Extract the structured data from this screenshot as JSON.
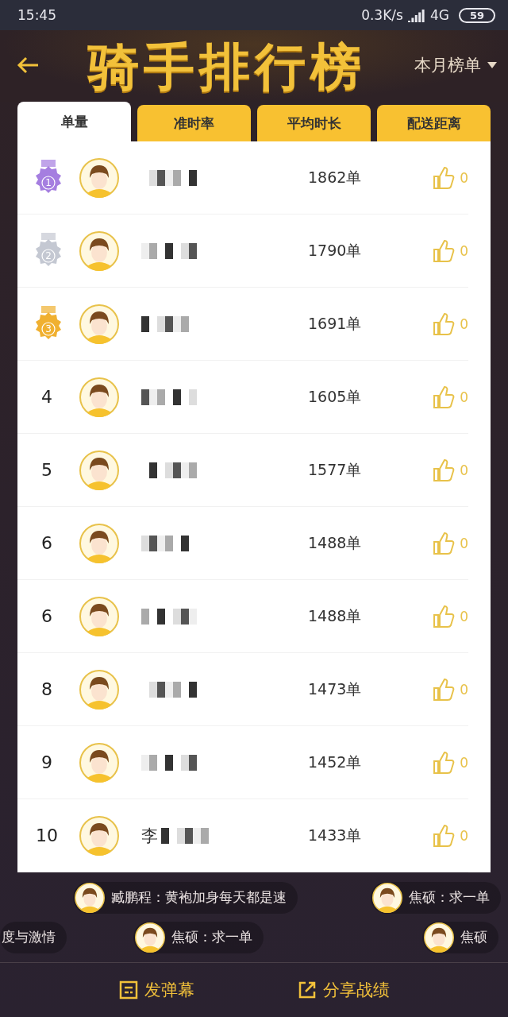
{
  "status_bar": {
    "time": "15:45",
    "speed": "0.3K/s",
    "network": "4G",
    "battery": "59"
  },
  "header": {
    "title": "骑手排行榜",
    "period": "本月榜单"
  },
  "tabs": [
    {
      "label": "单量",
      "selected": true
    },
    {
      "label": "准时率",
      "selected": false
    },
    {
      "label": "平均时长",
      "selected": false
    },
    {
      "label": "配送距离",
      "selected": false
    }
  ],
  "rows": [
    {
      "kind": "medal",
      "rank": "1",
      "color": "#a57ee0",
      "value": "1862单",
      "likes": "0"
    },
    {
      "kind": "medal",
      "rank": "2",
      "color": "#c4c8d2",
      "value": "1790单",
      "likes": "0"
    },
    {
      "kind": "medal",
      "rank": "3",
      "color": "#f0b030",
      "value": "1691单",
      "likes": "0"
    },
    {
      "kind": "number",
      "rank": "4",
      "value": "1605单",
      "likes": "0"
    },
    {
      "kind": "number",
      "rank": "5",
      "value": "1577单",
      "likes": "0"
    },
    {
      "kind": "number",
      "rank": "6",
      "value": "1488单",
      "likes": "0"
    },
    {
      "kind": "number",
      "rank": "6",
      "value": "1488单",
      "likes": "0"
    },
    {
      "kind": "number",
      "rank": "8",
      "value": "1473单",
      "likes": "0"
    },
    {
      "kind": "number",
      "rank": "9",
      "value": "1452单",
      "likes": "0"
    },
    {
      "kind": "number",
      "rank": "10",
      "name": "李",
      "value": "1433单",
      "likes": "0"
    }
  ],
  "danmaku": [
    [
      {
        "text": "臧鹏程：黄袍加身每天都是速",
        "avatar": true
      },
      {
        "text": "焦硕：求一单",
        "avatar": true
      }
    ],
    [
      {
        "text": "度与激情",
        "avatar": false
      },
      {
        "text": "焦硕：求一单",
        "avatar": true
      },
      {
        "text": "焦硕",
        "avatar": true
      }
    ]
  ],
  "actions": [
    {
      "kind": "danmaku",
      "label": "发弹幕"
    },
    {
      "kind": "share",
      "label": "分享战绩"
    }
  ]
}
